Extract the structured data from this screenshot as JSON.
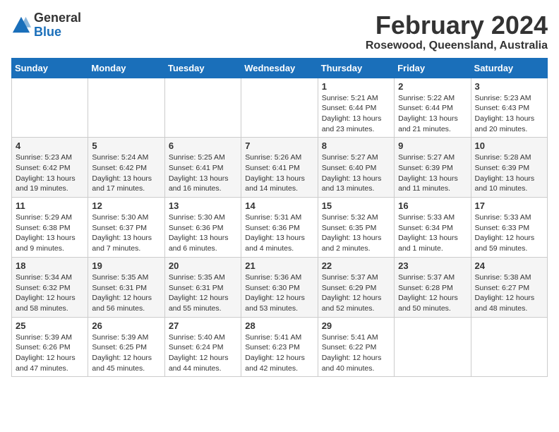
{
  "header": {
    "logo_general": "General",
    "logo_blue": "Blue",
    "month_title": "February 2024",
    "location": "Rosewood, Queensland, Australia"
  },
  "days_of_week": [
    "Sunday",
    "Monday",
    "Tuesday",
    "Wednesday",
    "Thursday",
    "Friday",
    "Saturday"
  ],
  "weeks": [
    [
      {
        "day": "",
        "info": ""
      },
      {
        "day": "",
        "info": ""
      },
      {
        "day": "",
        "info": ""
      },
      {
        "day": "",
        "info": ""
      },
      {
        "day": "1",
        "info": "Sunrise: 5:21 AM\nSunset: 6:44 PM\nDaylight: 13 hours\nand 23 minutes."
      },
      {
        "day": "2",
        "info": "Sunrise: 5:22 AM\nSunset: 6:44 PM\nDaylight: 13 hours\nand 21 minutes."
      },
      {
        "day": "3",
        "info": "Sunrise: 5:23 AM\nSunset: 6:43 PM\nDaylight: 13 hours\nand 20 minutes."
      }
    ],
    [
      {
        "day": "4",
        "info": "Sunrise: 5:23 AM\nSunset: 6:42 PM\nDaylight: 13 hours\nand 19 minutes."
      },
      {
        "day": "5",
        "info": "Sunrise: 5:24 AM\nSunset: 6:42 PM\nDaylight: 13 hours\nand 17 minutes."
      },
      {
        "day": "6",
        "info": "Sunrise: 5:25 AM\nSunset: 6:41 PM\nDaylight: 13 hours\nand 16 minutes."
      },
      {
        "day": "7",
        "info": "Sunrise: 5:26 AM\nSunset: 6:41 PM\nDaylight: 13 hours\nand 14 minutes."
      },
      {
        "day": "8",
        "info": "Sunrise: 5:27 AM\nSunset: 6:40 PM\nDaylight: 13 hours\nand 13 minutes."
      },
      {
        "day": "9",
        "info": "Sunrise: 5:27 AM\nSunset: 6:39 PM\nDaylight: 13 hours\nand 11 minutes."
      },
      {
        "day": "10",
        "info": "Sunrise: 5:28 AM\nSunset: 6:39 PM\nDaylight: 13 hours\nand 10 minutes."
      }
    ],
    [
      {
        "day": "11",
        "info": "Sunrise: 5:29 AM\nSunset: 6:38 PM\nDaylight: 13 hours\nand 9 minutes."
      },
      {
        "day": "12",
        "info": "Sunrise: 5:30 AM\nSunset: 6:37 PM\nDaylight: 13 hours\nand 7 minutes."
      },
      {
        "day": "13",
        "info": "Sunrise: 5:30 AM\nSunset: 6:36 PM\nDaylight: 13 hours\nand 6 minutes."
      },
      {
        "day": "14",
        "info": "Sunrise: 5:31 AM\nSunset: 6:36 PM\nDaylight: 13 hours\nand 4 minutes."
      },
      {
        "day": "15",
        "info": "Sunrise: 5:32 AM\nSunset: 6:35 PM\nDaylight: 13 hours\nand 2 minutes."
      },
      {
        "day": "16",
        "info": "Sunrise: 5:33 AM\nSunset: 6:34 PM\nDaylight: 13 hours\nand 1 minute."
      },
      {
        "day": "17",
        "info": "Sunrise: 5:33 AM\nSunset: 6:33 PM\nDaylight: 12 hours\nand 59 minutes."
      }
    ],
    [
      {
        "day": "18",
        "info": "Sunrise: 5:34 AM\nSunset: 6:32 PM\nDaylight: 12 hours\nand 58 minutes."
      },
      {
        "day": "19",
        "info": "Sunrise: 5:35 AM\nSunset: 6:31 PM\nDaylight: 12 hours\nand 56 minutes."
      },
      {
        "day": "20",
        "info": "Sunrise: 5:35 AM\nSunset: 6:31 PM\nDaylight: 12 hours\nand 55 minutes."
      },
      {
        "day": "21",
        "info": "Sunrise: 5:36 AM\nSunset: 6:30 PM\nDaylight: 12 hours\nand 53 minutes."
      },
      {
        "day": "22",
        "info": "Sunrise: 5:37 AM\nSunset: 6:29 PM\nDaylight: 12 hours\nand 52 minutes."
      },
      {
        "day": "23",
        "info": "Sunrise: 5:37 AM\nSunset: 6:28 PM\nDaylight: 12 hours\nand 50 minutes."
      },
      {
        "day": "24",
        "info": "Sunrise: 5:38 AM\nSunset: 6:27 PM\nDaylight: 12 hours\nand 48 minutes."
      }
    ],
    [
      {
        "day": "25",
        "info": "Sunrise: 5:39 AM\nSunset: 6:26 PM\nDaylight: 12 hours\nand 47 minutes."
      },
      {
        "day": "26",
        "info": "Sunrise: 5:39 AM\nSunset: 6:25 PM\nDaylight: 12 hours\nand 45 minutes."
      },
      {
        "day": "27",
        "info": "Sunrise: 5:40 AM\nSunset: 6:24 PM\nDaylight: 12 hours\nand 44 minutes."
      },
      {
        "day": "28",
        "info": "Sunrise: 5:41 AM\nSunset: 6:23 PM\nDaylight: 12 hours\nand 42 minutes."
      },
      {
        "day": "29",
        "info": "Sunrise: 5:41 AM\nSunset: 6:22 PM\nDaylight: 12 hours\nand 40 minutes."
      },
      {
        "day": "",
        "info": ""
      },
      {
        "day": "",
        "info": ""
      }
    ]
  ]
}
